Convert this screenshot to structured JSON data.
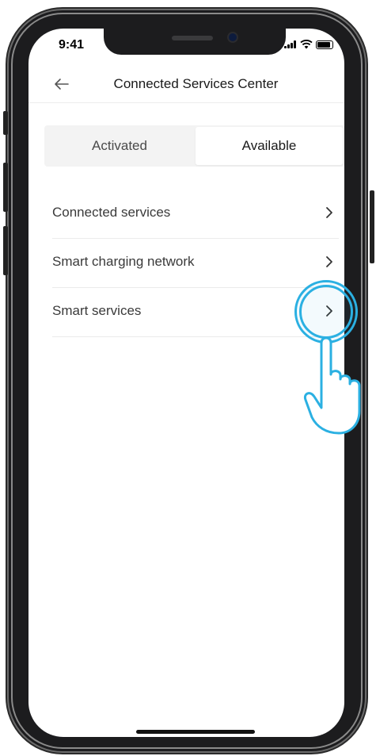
{
  "status_bar": {
    "time": "9:41"
  },
  "nav": {
    "title": "Connected Services Center",
    "back_icon": "arrow-left-icon"
  },
  "tabs": [
    {
      "label": "Activated",
      "selected": false
    },
    {
      "label": "Available",
      "selected": true
    }
  ],
  "list": {
    "items": [
      {
        "label": "Connected services",
        "icon": "chevron-right-icon"
      },
      {
        "label": "Smart charging network",
        "icon": "chevron-right-icon"
      },
      {
        "label": "Smart services",
        "icon": "chevron-right-icon"
      }
    ]
  },
  "colors": {
    "tap_highlight": "#2bb0e2",
    "divider": "#ebebeb",
    "segment_bg": "#f3f3f3"
  }
}
